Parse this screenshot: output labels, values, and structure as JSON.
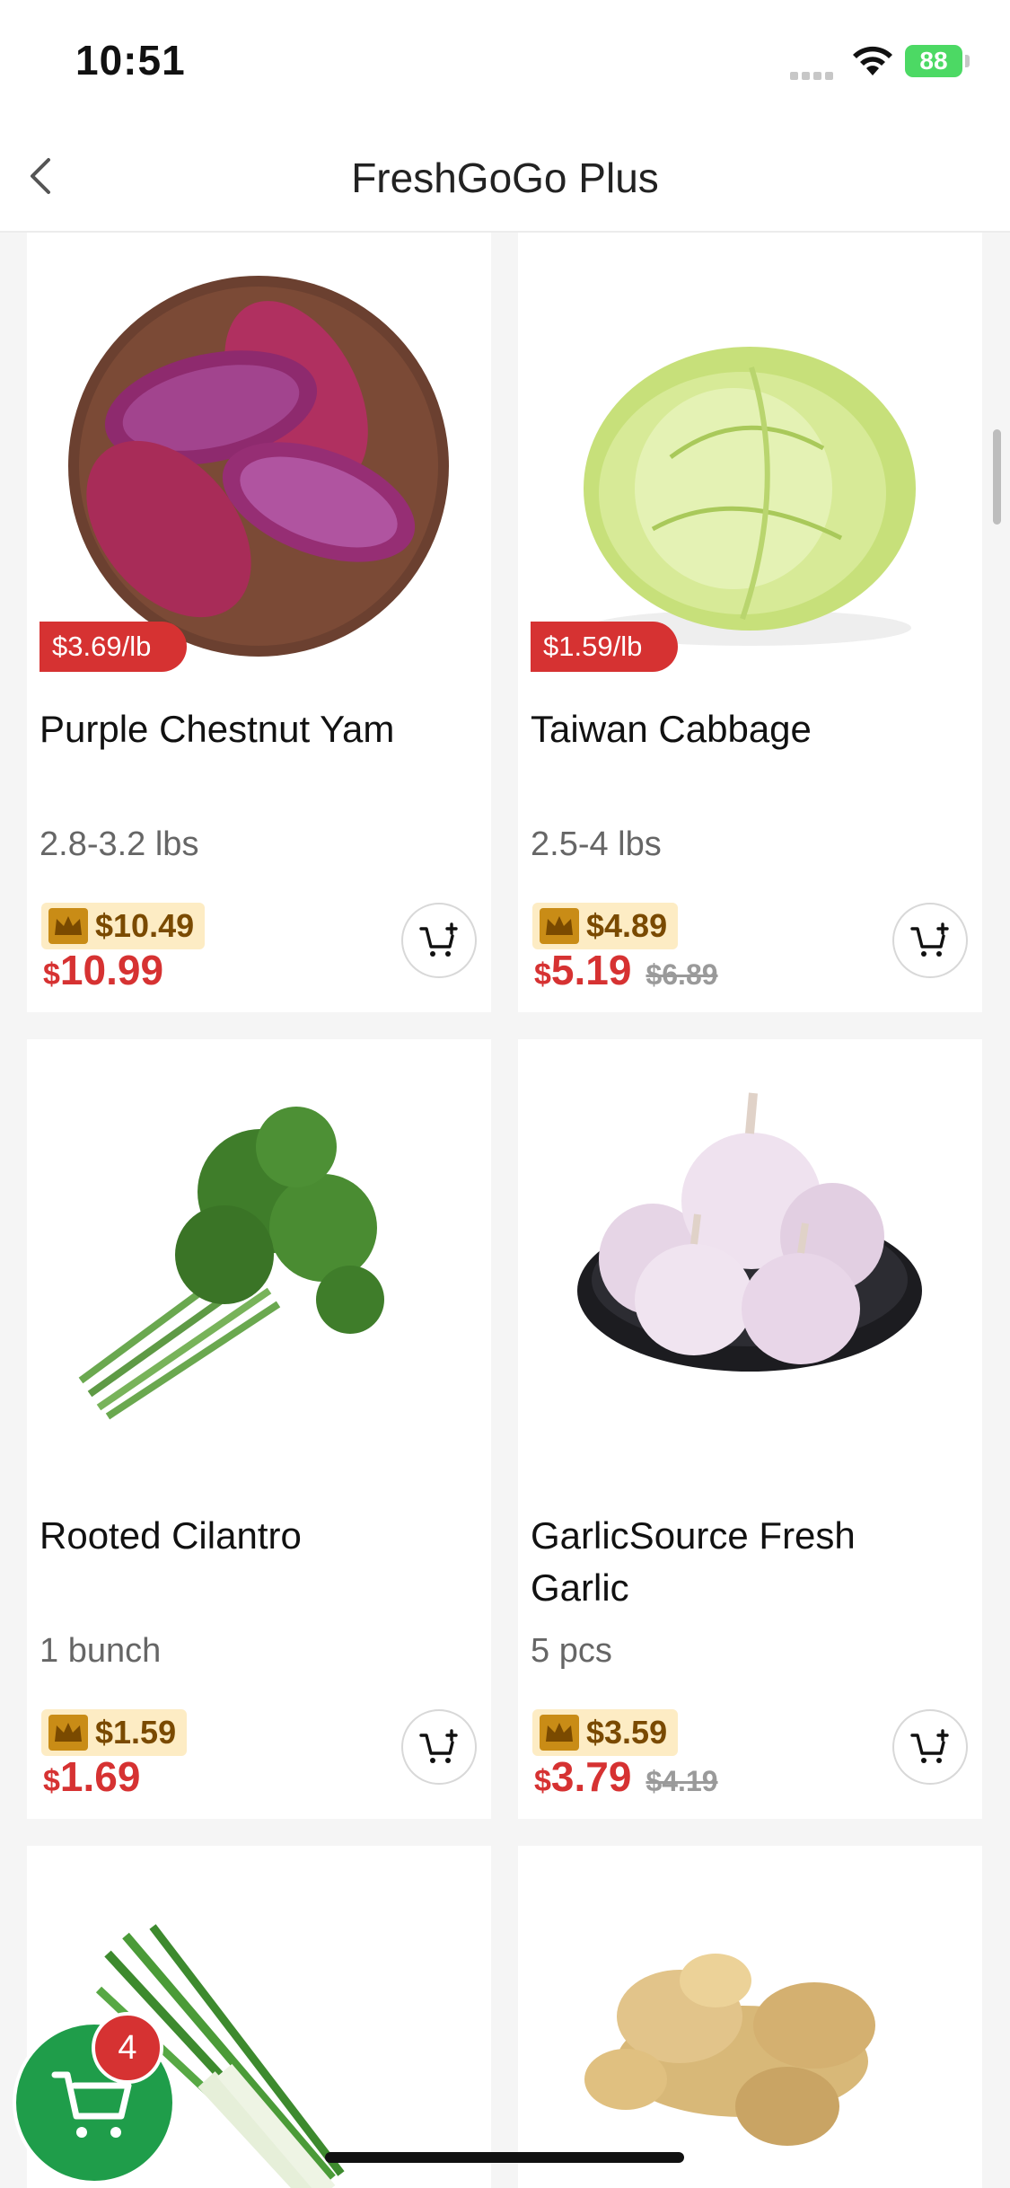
{
  "status_bar": {
    "time": "10:51",
    "battery": "88"
  },
  "nav": {
    "title": "FreshGoGo Plus"
  },
  "products": [
    {
      "name": "Purple Chestnut Yam",
      "unit_price": "$3.69/lb",
      "size": "2.8-3.2 lbs",
      "member_price": "$10.49",
      "currency": "$",
      "price": "10.99",
      "original_price": ""
    },
    {
      "name": "Taiwan Cabbage",
      "unit_price": "$1.59/lb",
      "size": "2.5-4 lbs",
      "member_price": "$4.89",
      "currency": "$",
      "price": "5.19",
      "original_price": "$6.89"
    },
    {
      "name": "Rooted Cilantro",
      "unit_price": "",
      "size": "1 bunch",
      "member_price": "$1.59",
      "currency": "$",
      "price": "1.69",
      "original_price": ""
    },
    {
      "name": "GarlicSource Fresh Garlic",
      "unit_price": "",
      "size": "5 pcs",
      "member_price": "$3.59",
      "currency": "$",
      "price": "3.79",
      "original_price": "$4.19"
    },
    {
      "name": "",
      "unit_price": "",
      "size": "",
      "member_price": "",
      "currency": "",
      "price": "",
      "original_price": ""
    },
    {
      "name": "",
      "unit_price": "",
      "size": "",
      "member_price": "",
      "currency": "",
      "price": "",
      "original_price": ""
    }
  ],
  "cart": {
    "count": "4"
  },
  "colors": {
    "accent_red": "#d63232",
    "cart_green": "#1f9d4a",
    "member_gold": "#fdecc4"
  }
}
